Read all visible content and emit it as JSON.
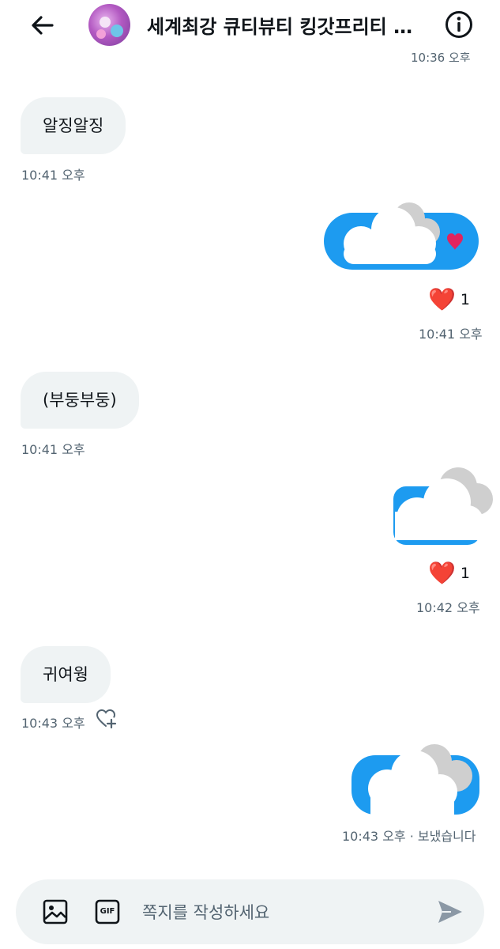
{
  "header": {
    "title": "세계최강 큐티뷰티 킹갓프리티 …"
  },
  "messages": {
    "m1": {
      "text": "알징알징",
      "time": "10:41 오후"
    },
    "m2": {
      "reaction_emoji": "❤️",
      "reaction_count": "1",
      "time": "10:41 오후"
    },
    "m3": {
      "text": "(부둥부둥)",
      "time": "10:41 오후"
    },
    "m4": {
      "reaction_emoji": "❤️",
      "reaction_count": "1",
      "time": "10:42 오후"
    },
    "m5": {
      "text": "귀여웡",
      "time": "10:43 오후"
    },
    "m6": {
      "time": "10:43 오후 · 보냈습니다"
    }
  },
  "composer": {
    "placeholder": "쪽지를 작성하세요",
    "gif_label": "GIF"
  },
  "colors": {
    "accent": "#1d9bf0",
    "incoming_bubble": "#eff3f4",
    "secondary_text": "#536471",
    "cloud_white": "#ffffff",
    "cloud_gray": "#cfcfcf",
    "heart_red": "#e0245e"
  }
}
